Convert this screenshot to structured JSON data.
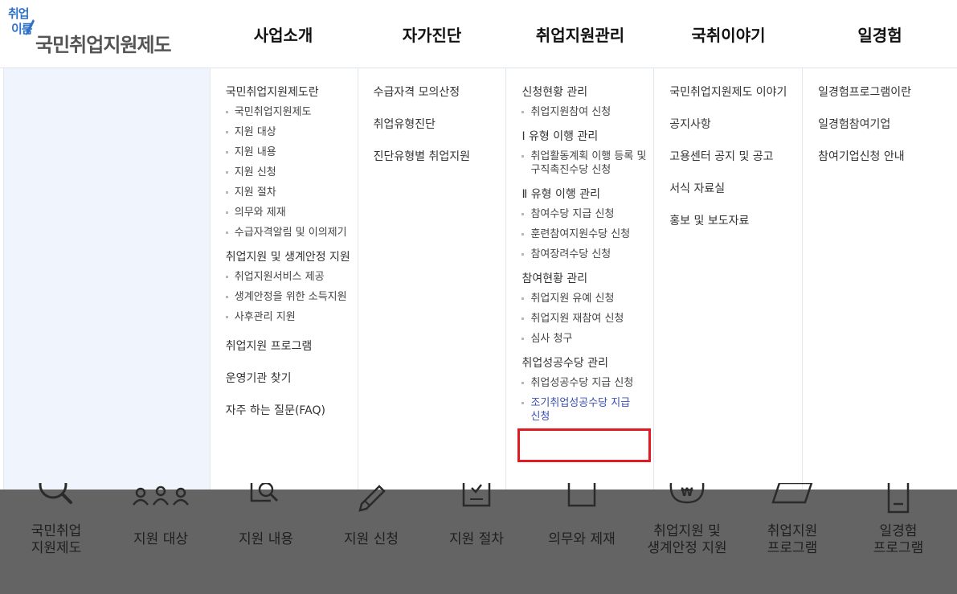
{
  "logo": {
    "mark_top": "취업",
    "mark_bottom": "이룸",
    "title": "국민취업지원제도"
  },
  "gnb": [
    {
      "label": "사업소개"
    },
    {
      "label": "자가진단"
    },
    {
      "label": "취업지원관리"
    },
    {
      "label": "국취이야기"
    },
    {
      "label": "일경험"
    }
  ],
  "menu": {
    "col1": {
      "g1": {
        "title": "국민취업지원제도란",
        "items": [
          "국민취업지원제도",
          "지원 대상",
          "지원 내용",
          "지원 신청",
          "지원 절차",
          "의무와 제재",
          "수급자격알림 및 이의제기"
        ]
      },
      "g2": {
        "title": "취업지원 및 생계안정 지원",
        "items": [
          "취업지원서비스 제공",
          "생계안정을 위한 소득지원",
          "사후관리 지원"
        ]
      },
      "l3": "취업지원 프로그램",
      "l4": "운영기관 찾기",
      "l5": "자주 하는 질문(FAQ)"
    },
    "col2": [
      "수급자격 모의산정",
      "취업유형진단",
      "진단유형별 취업지원"
    ],
    "col3": {
      "g1": {
        "title": "신청현황 관리",
        "items": [
          "취업지원참여 신청"
        ]
      },
      "g2": {
        "title": "Ⅰ 유형 이행 관리",
        "items": [
          "취업활동계획 이행 등록 및 구직촉진수당 신청"
        ]
      },
      "g3": {
        "title": "Ⅱ 유형 이행 관리",
        "items": [
          "참여수당 지급 신청",
          "훈련참여지원수당 신청",
          "참여장려수당 신청"
        ]
      },
      "g4": {
        "title": "참여현황 관리",
        "items": [
          "취업지원 유예 신청",
          "취업지원 재참여 신청",
          "심사 청구"
        ]
      },
      "g5": {
        "title": "취업성공수당 관리",
        "items": [
          "취업성공수당 지급 신청",
          "조기취업성공수당 지급 신청"
        ]
      }
    },
    "col4": [
      "국민취업지원제도 이야기",
      "공지사항",
      "고용센터 공지 및 공고",
      "서식 자료실",
      "홍보 및 보도자료"
    ],
    "col5": [
      "일경험프로그램이란",
      "일경험참여기업",
      "참여기업신청 안내"
    ]
  },
  "quick_menu": [
    {
      "label_1": "국민취업",
      "label_2": "지원제도",
      "icon": "magnifier-icon"
    },
    {
      "label_1": "지원 대상",
      "label_2": "",
      "icon": "people-icon"
    },
    {
      "label_1": "지원 내용",
      "label_2": "",
      "icon": "document-search-icon"
    },
    {
      "label_1": "지원 신청",
      "label_2": "",
      "icon": "pencil-icon"
    },
    {
      "label_1": "지원 절차",
      "label_2": "",
      "icon": "clipboard-check-icon"
    },
    {
      "label_1": "의무와 제재",
      "label_2": "",
      "icon": "document-icon"
    },
    {
      "label_1": "취업지원 및",
      "label_2": "생계안정 지원",
      "icon": "money-bag-icon"
    },
    {
      "label_1": "취업지원",
      "label_2": "프로그램",
      "icon": "folder-icon"
    },
    {
      "label_1": "일경험",
      "label_2": "프로그램",
      "icon": "id-card-icon"
    }
  ],
  "colors": {
    "logo_blue": "#2f73c9",
    "logo_text": "#555555",
    "active_link": "#3a4fb5",
    "highlight": "#e21b23",
    "dim_overlay": "#646464"
  }
}
